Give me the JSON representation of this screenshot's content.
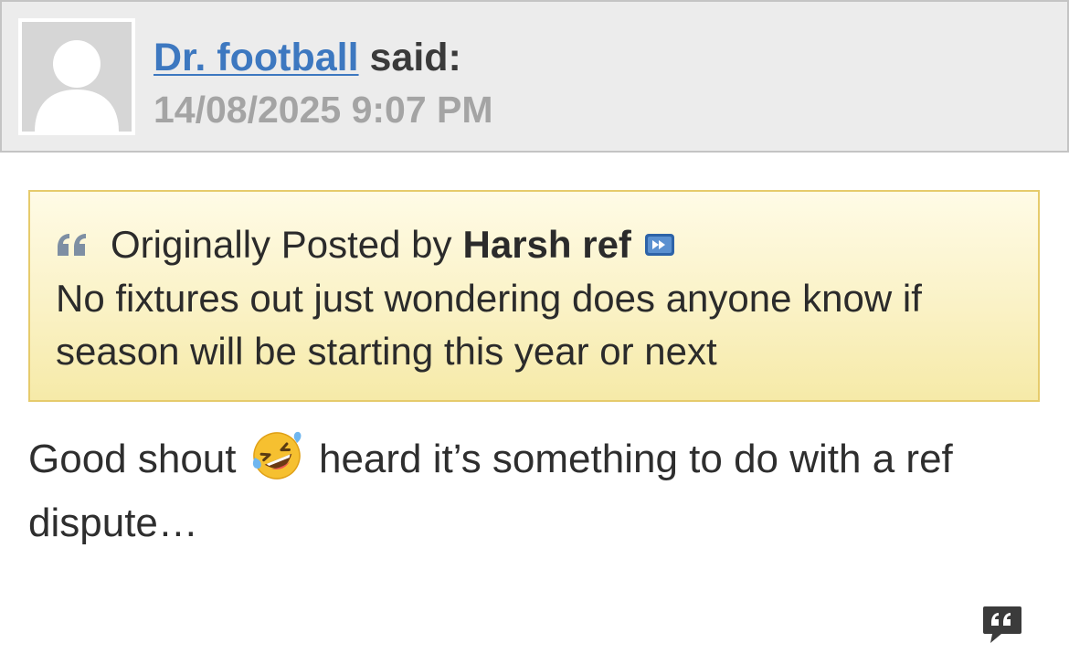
{
  "post": {
    "author": "Dr. football",
    "said_label": "said:",
    "date": "14/08/2025 9:07 PM",
    "avatar_icon": "default-avatar-icon"
  },
  "quote": {
    "prefix": "Originally Posted by",
    "author": "Harsh ref",
    "text": "No fixtures out just wondering does anyone know if season will be starting this year or next",
    "quote_icon": "quote-marks-icon",
    "view_post_icon": "view-post-icon"
  },
  "message": {
    "text_before_emoji": "Good shout",
    "emoji": "rolling-on-floor-laughing",
    "text_after_emoji": "heard it’s something to do with a ref dispute…"
  },
  "actions": {
    "reply_with_quote_icon": "reply-with-quote-icon"
  },
  "colors": {
    "header_bg": "#ececec",
    "link": "#3d78c0",
    "date": "#a4a4a4",
    "quote_border": "#e6cb6c",
    "quote_bg": "#faf2c6"
  }
}
